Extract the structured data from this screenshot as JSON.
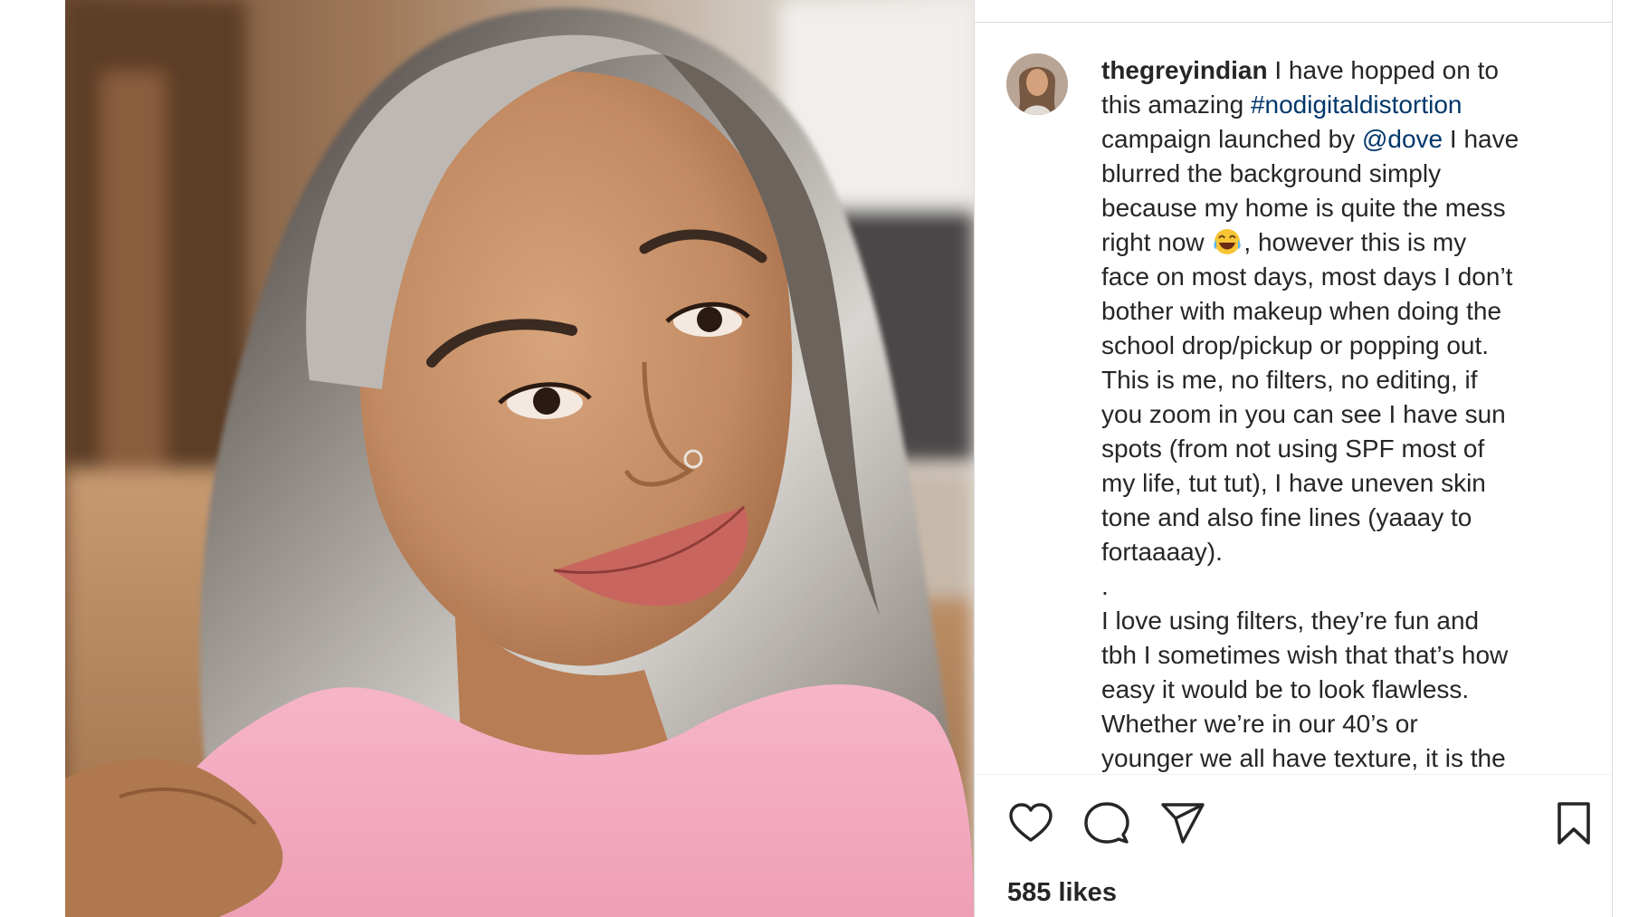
{
  "post": {
    "username": "thegreyindian",
    "caption_lines": [
      [
        {
          "t": "username",
          "v": "thegreyindian"
        },
        {
          "t": "text",
          "v": " I have hopped on to"
        }
      ],
      [
        {
          "t": "text",
          "v": "this amazing "
        },
        {
          "t": "tag",
          "v": "#nodigitaldistortion"
        }
      ],
      [
        {
          "t": "text",
          "v": "campaign launched by "
        },
        {
          "t": "tag",
          "v": "@dove"
        },
        {
          "t": "text",
          "v": " I have"
        }
      ],
      [
        {
          "t": "text",
          "v": "blurred the background simply"
        }
      ],
      [
        {
          "t": "text",
          "v": "because my home is quite the mess"
        }
      ],
      [
        {
          "t": "text",
          "v": "right now "
        },
        {
          "t": "emoji",
          "v": "😂"
        },
        {
          "t": "text",
          "v": ", however this is my"
        }
      ],
      [
        {
          "t": "text",
          "v": "face on most days, most days I don’t"
        }
      ],
      [
        {
          "t": "text",
          "v": "bother with makeup when doing the"
        }
      ],
      [
        {
          "t": "text",
          "v": "school drop/pickup or popping out."
        }
      ],
      [
        {
          "t": "text",
          "v": "This is me, no filters, no editing, if"
        }
      ],
      [
        {
          "t": "text",
          "v": "you zoom in you can see I have sun"
        }
      ],
      [
        {
          "t": "text",
          "v": "spots (from not using SPF most of"
        }
      ],
      [
        {
          "t": "text",
          "v": "my life, tut tut), I have uneven skin"
        }
      ],
      [
        {
          "t": "text",
          "v": "tone and also fine lines (yaaay to"
        }
      ],
      [
        {
          "t": "text",
          "v": "fortaaaay)."
        }
      ],
      [
        {
          "t": "text",
          "v": "."
        }
      ],
      [
        {
          "t": "text",
          "v": "I love using filters, they’re fun and"
        }
      ],
      [
        {
          "t": "text",
          "v": "tbh I sometimes wish that that’s how"
        }
      ],
      [
        {
          "t": "text",
          "v": "easy it would be to look flawless."
        }
      ],
      [
        {
          "t": "text",
          "v": "Whether we’re in our 40’s or"
        }
      ],
      [
        {
          "t": "text",
          "v": "younger we all have texture, it is the"
        }
      ]
    ],
    "likes": "585 likes"
  },
  "actions": {
    "like_icon": "heart-icon",
    "comment_icon": "comment-bubble-icon",
    "share_icon": "paper-plane-icon",
    "save_icon": "bookmark-icon"
  },
  "colors": {
    "text": "#262626",
    "link": "#00376b",
    "border": "#dbdbdb",
    "shirt": "#f4a9bf"
  }
}
